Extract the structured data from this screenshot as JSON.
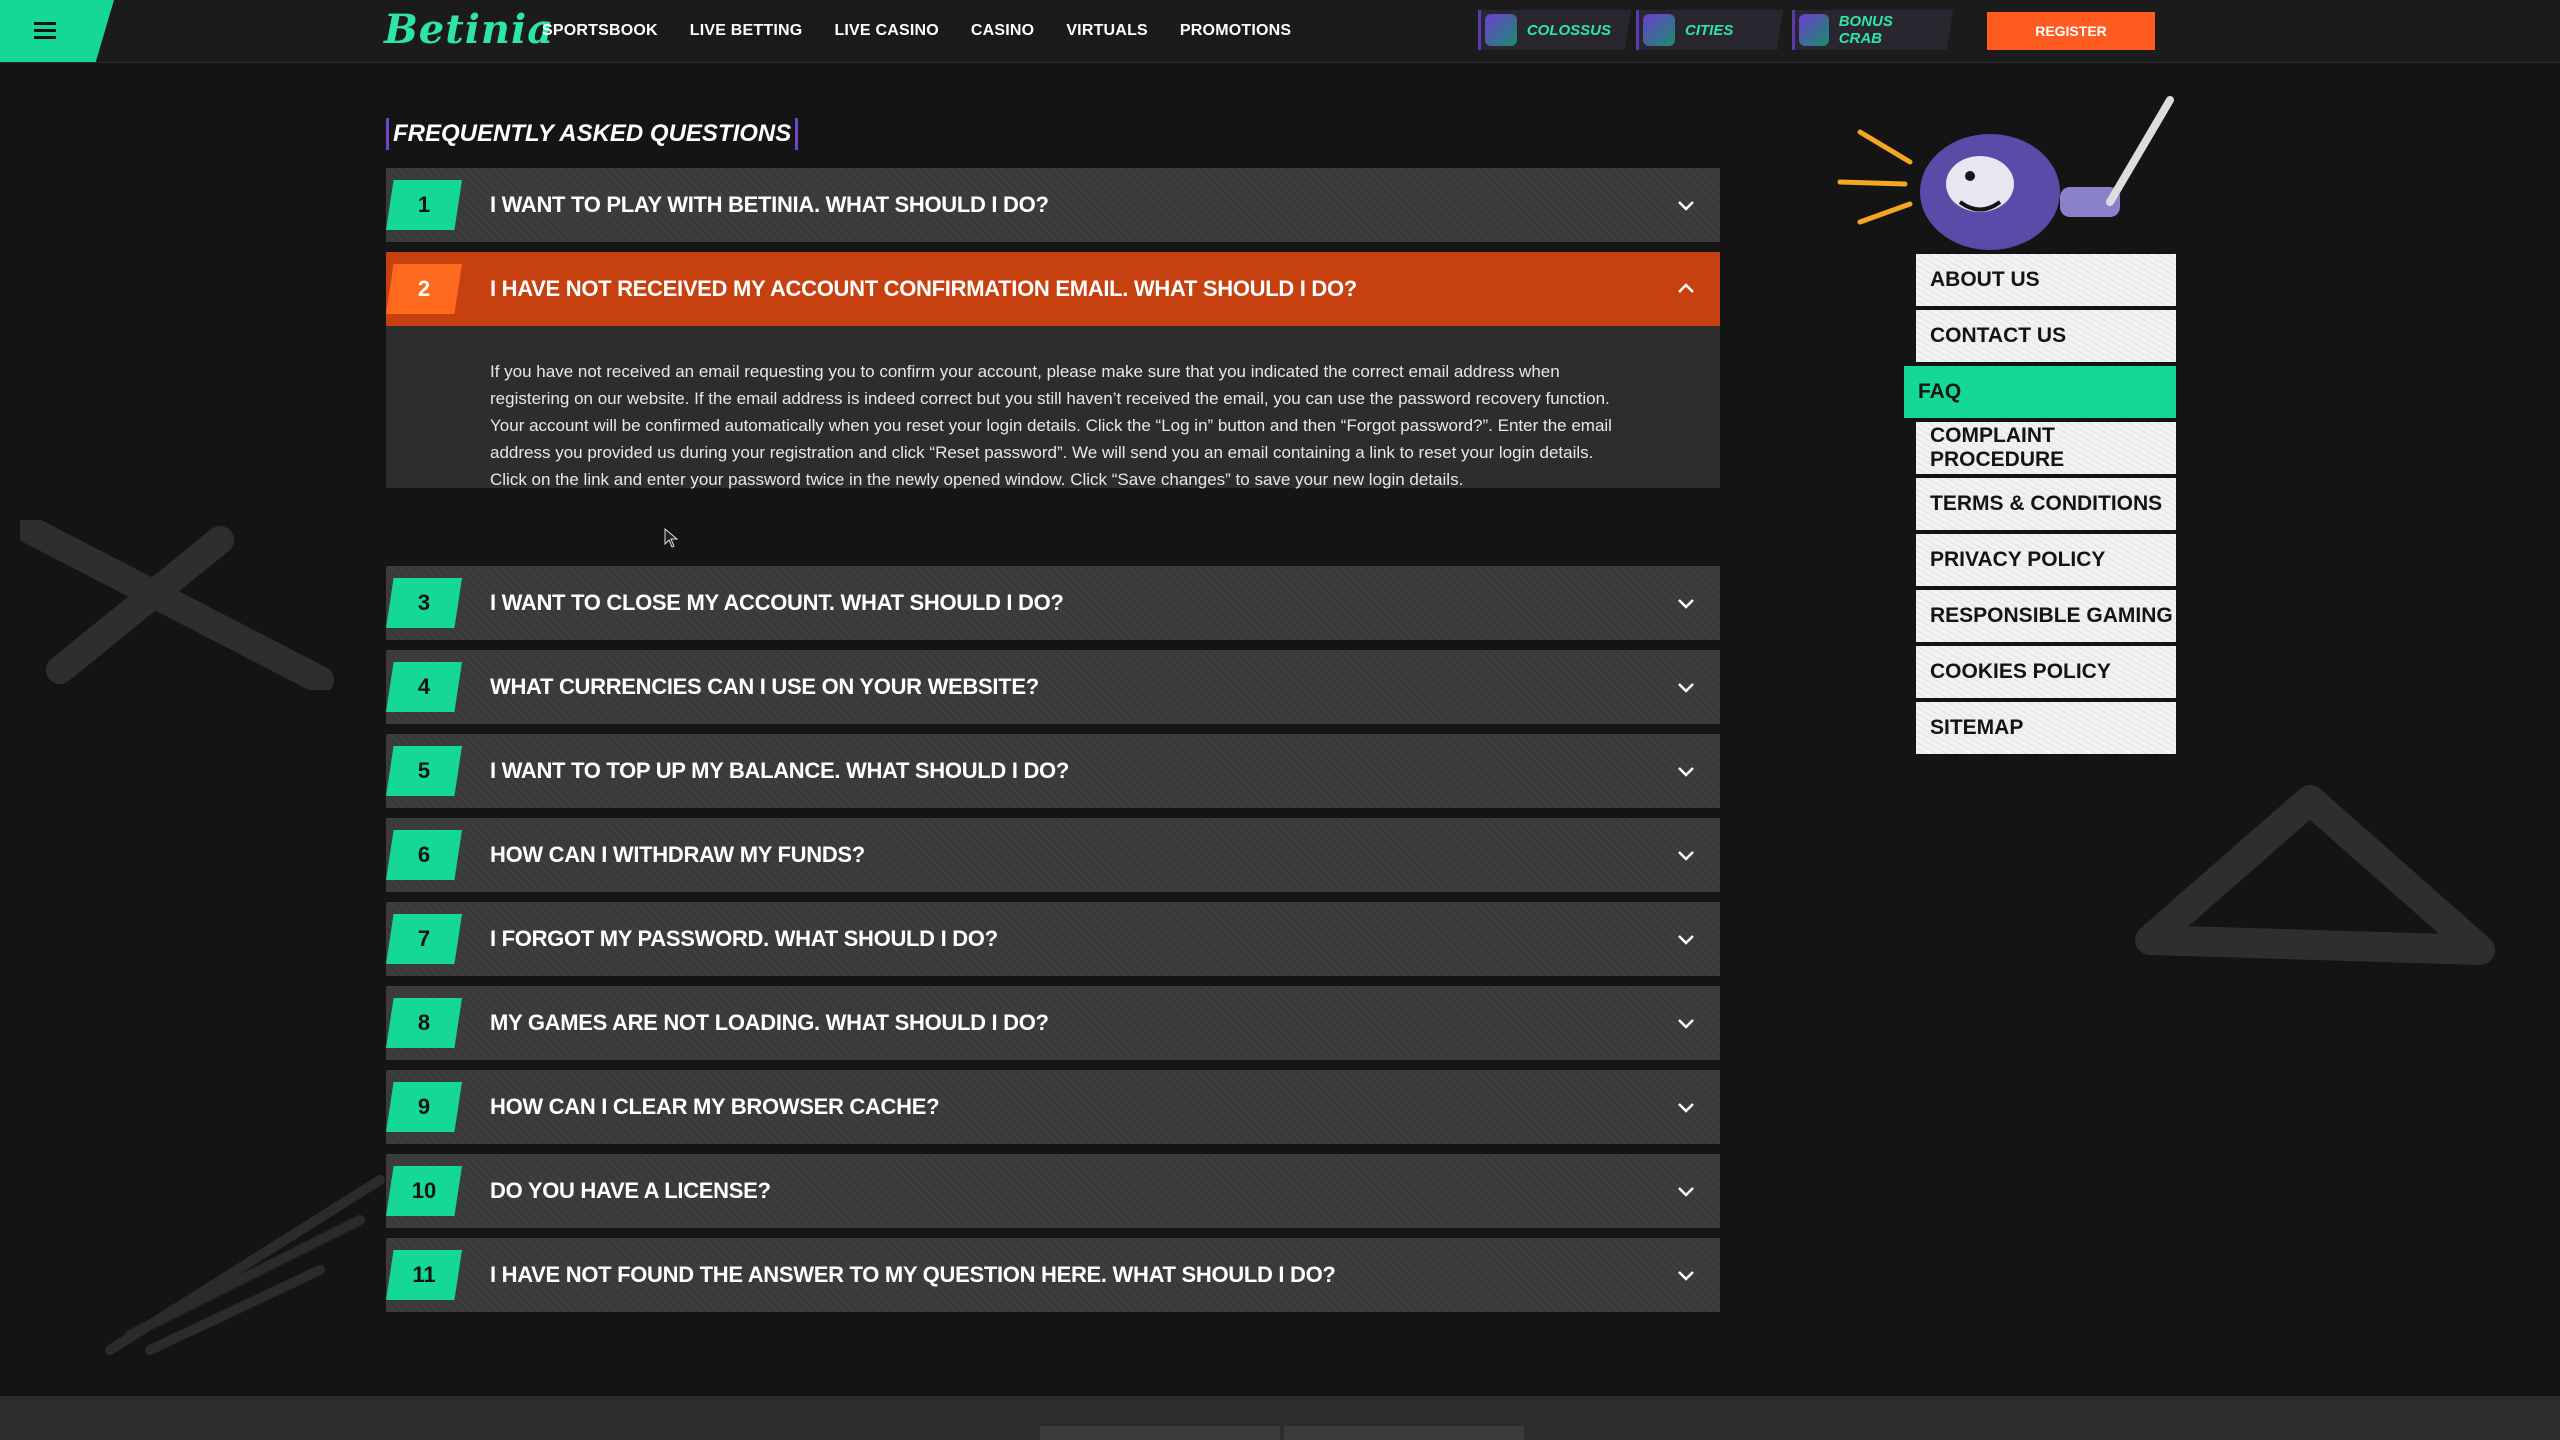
{
  "header": {
    "logo": "Betinia",
    "nav": [
      "SPORTSBOOK",
      "LIVE BETTING",
      "LIVE CASINO",
      "CASINO",
      "VIRTUALS",
      "PROMOTIONS"
    ],
    "promos": [
      {
        "label": "COLOSSUS"
      },
      {
        "label": "CITIES"
      },
      {
        "label": "BONUS CRAB"
      }
    ],
    "register_label": "REGISTER"
  },
  "faq": {
    "title": "FREQUENTLY ASKED QUESTIONS",
    "items": [
      {
        "num": "1",
        "question": "I want to play with Betinia. What should I do?"
      },
      {
        "num": "2",
        "question": "I have not received my account confirmation email. What should I do?",
        "open": true,
        "answer": "If you have not received an email requesting you to confirm your account, please make sure that you indicated the correct email address when registering on our website. If the email address is indeed correct but you still haven’t received the email, you can use the password recovery function. Your account will be confirmed automatically when you reset your login details. Click the “Log in” button and then “Forgot password?”. Enter the email address you provided us during your registration and click “Reset password”. We will send you an email containing a link to reset your login details. Click on the link and enter your password twice in the newly opened window. Click “Save changes” to save your new login details."
      },
      {
        "num": "3",
        "question": "I want to close my account. What should I do?"
      },
      {
        "num": "4",
        "question": "What currencies can I use on your website?"
      },
      {
        "num": "5",
        "question": "I want to top up my balance. What should I do?"
      },
      {
        "num": "6",
        "question": "How can I withdraw my funds?"
      },
      {
        "num": "7",
        "question": "I forgot my password. What should I do?"
      },
      {
        "num": "8",
        "question": "My games are not loading. What should I do?"
      },
      {
        "num": "9",
        "question": "How can I clear my browser cache?"
      },
      {
        "num": "10",
        "question": "Do you have a license?"
      },
      {
        "num": "11",
        "question": "I have not found the answer to my question here. What should I do?"
      }
    ]
  },
  "sidebar": {
    "items": [
      {
        "label": "About us"
      },
      {
        "label": "Contact us"
      },
      {
        "label": "FAQ",
        "active": true
      },
      {
        "label": "Complaint procedure"
      },
      {
        "label": "Terms & Conditions"
      },
      {
        "label": "Privacy policy"
      },
      {
        "label": "Responsible gaming"
      },
      {
        "label": "Cookies policy"
      },
      {
        "label": "Sitemap"
      }
    ]
  },
  "colors": {
    "accent_green": "#15d796",
    "accent_orange": "#ff5a1f",
    "open_row": "#c6410f",
    "background": "#141414"
  },
  "icons": {
    "menu": "hamburger-icon",
    "chevron": "chevron-down-icon",
    "chevron_open": "chevron-up-icon"
  }
}
